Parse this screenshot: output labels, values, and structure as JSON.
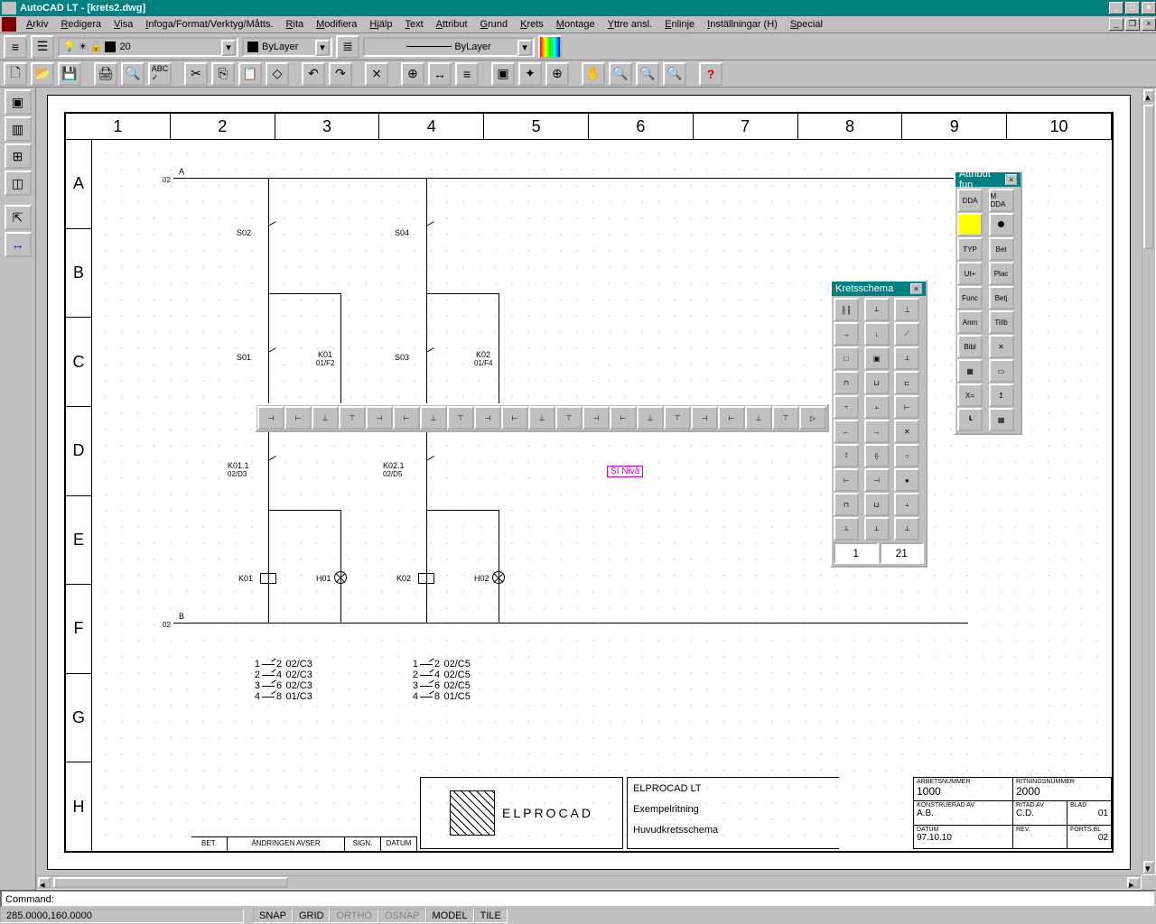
{
  "app_title": "AutoCAD LT - [krets2.dwg]",
  "menu": [
    "Arkiv",
    "Redigera",
    "Visa",
    "Infoga/Format/Verktyg/Måtts.",
    "Rita",
    "Modifiera",
    "Hjälp",
    "Text",
    "Attribut",
    "Grund",
    "Krets",
    "Montage",
    "Yttre ansl.",
    "Enlinje",
    "Inställningar (H)",
    "Special"
  ],
  "props": {
    "layer": "20",
    "color_label": "ByLayer",
    "linetype_label": "ByLayer"
  },
  "palettes": {
    "krets_title": "Kretsschema",
    "attr_title": "Attribut fun",
    "attr_buttons": [
      "DDA",
      "M DDA",
      "☀",
      "●",
      "TYP",
      "Bet",
      "Ut+",
      "Plac",
      "Func",
      "Betj",
      "Anm",
      "Tillb",
      "Bibl",
      "✕",
      "▦",
      "▭",
      "X=",
      "↥",
      "┗",
      "▦"
    ]
  },
  "drawing": {
    "cols": [
      "1",
      "2",
      "3",
      "4",
      "5",
      "6",
      "7",
      "8",
      "9",
      "10"
    ],
    "rows": [
      "A",
      "B",
      "C",
      "D",
      "E",
      "F",
      "G",
      "H"
    ],
    "bus_top_label": "A",
    "bus_top_sub": "02",
    "bus_bot_label": "B",
    "bus_bot_sub": "02",
    "s02": "S02",
    "s04": "S04",
    "s01": "S01",
    "s03": "S03",
    "k01_label": "K01",
    "k01_ref": "01/F2",
    "k02_label": "K02",
    "k02_ref": "01/F4",
    "k011_label": "K01.1",
    "k011_ref": "02/D3",
    "k021_label": "K02.1",
    "k021_ref": "02/D5",
    "coil_k01": "K01",
    "coil_k02": "K02",
    "lamp_h01": "H01",
    "lamp_h02": "H02",
    "si": "SI Nivå",
    "xref1": [
      "02/C3",
      "02/C3",
      "02/C3",
      "01/C3"
    ],
    "xref2": [
      "02/C5",
      "02/C5",
      "02/C5",
      "01/C5"
    ]
  },
  "titleblock": {
    "line1": "ELPROCAD LT",
    "line2": "Exempelritning",
    "line3": "Huvudkretsschema",
    "arbetsnummer_h": "ARBETSNUMMER",
    "arbetsnummer_v": "1000",
    "ritningsnummer_h": "RITNINGSNUMMER",
    "ritningsnummer_v": "2000",
    "konstr_h": "KONSTRUERAD AV",
    "konstr_v": "A.B.",
    "ritad_h": "RITAD AV",
    "ritad_v": "C.D.",
    "blad_h": "BLAD",
    "blad_v": "01",
    "datum_h": "DATUM",
    "datum_v": "97.10.10",
    "rev_h": "REV.",
    "forts_h": "FORTS.BL",
    "forts_v": "02",
    "logo_text": "ELPROCAD",
    "rev_cols": [
      "BET.",
      "ÄNDRINGEN AVSER",
      "SIGN.",
      "DATUM"
    ]
  },
  "command": "Command:",
  "status": {
    "coords": "285.0000,160.0000",
    "toggles": [
      "SNAP",
      "GRID",
      "ORTHO",
      "OSNAP",
      "MODEL",
      "TILE"
    ]
  }
}
